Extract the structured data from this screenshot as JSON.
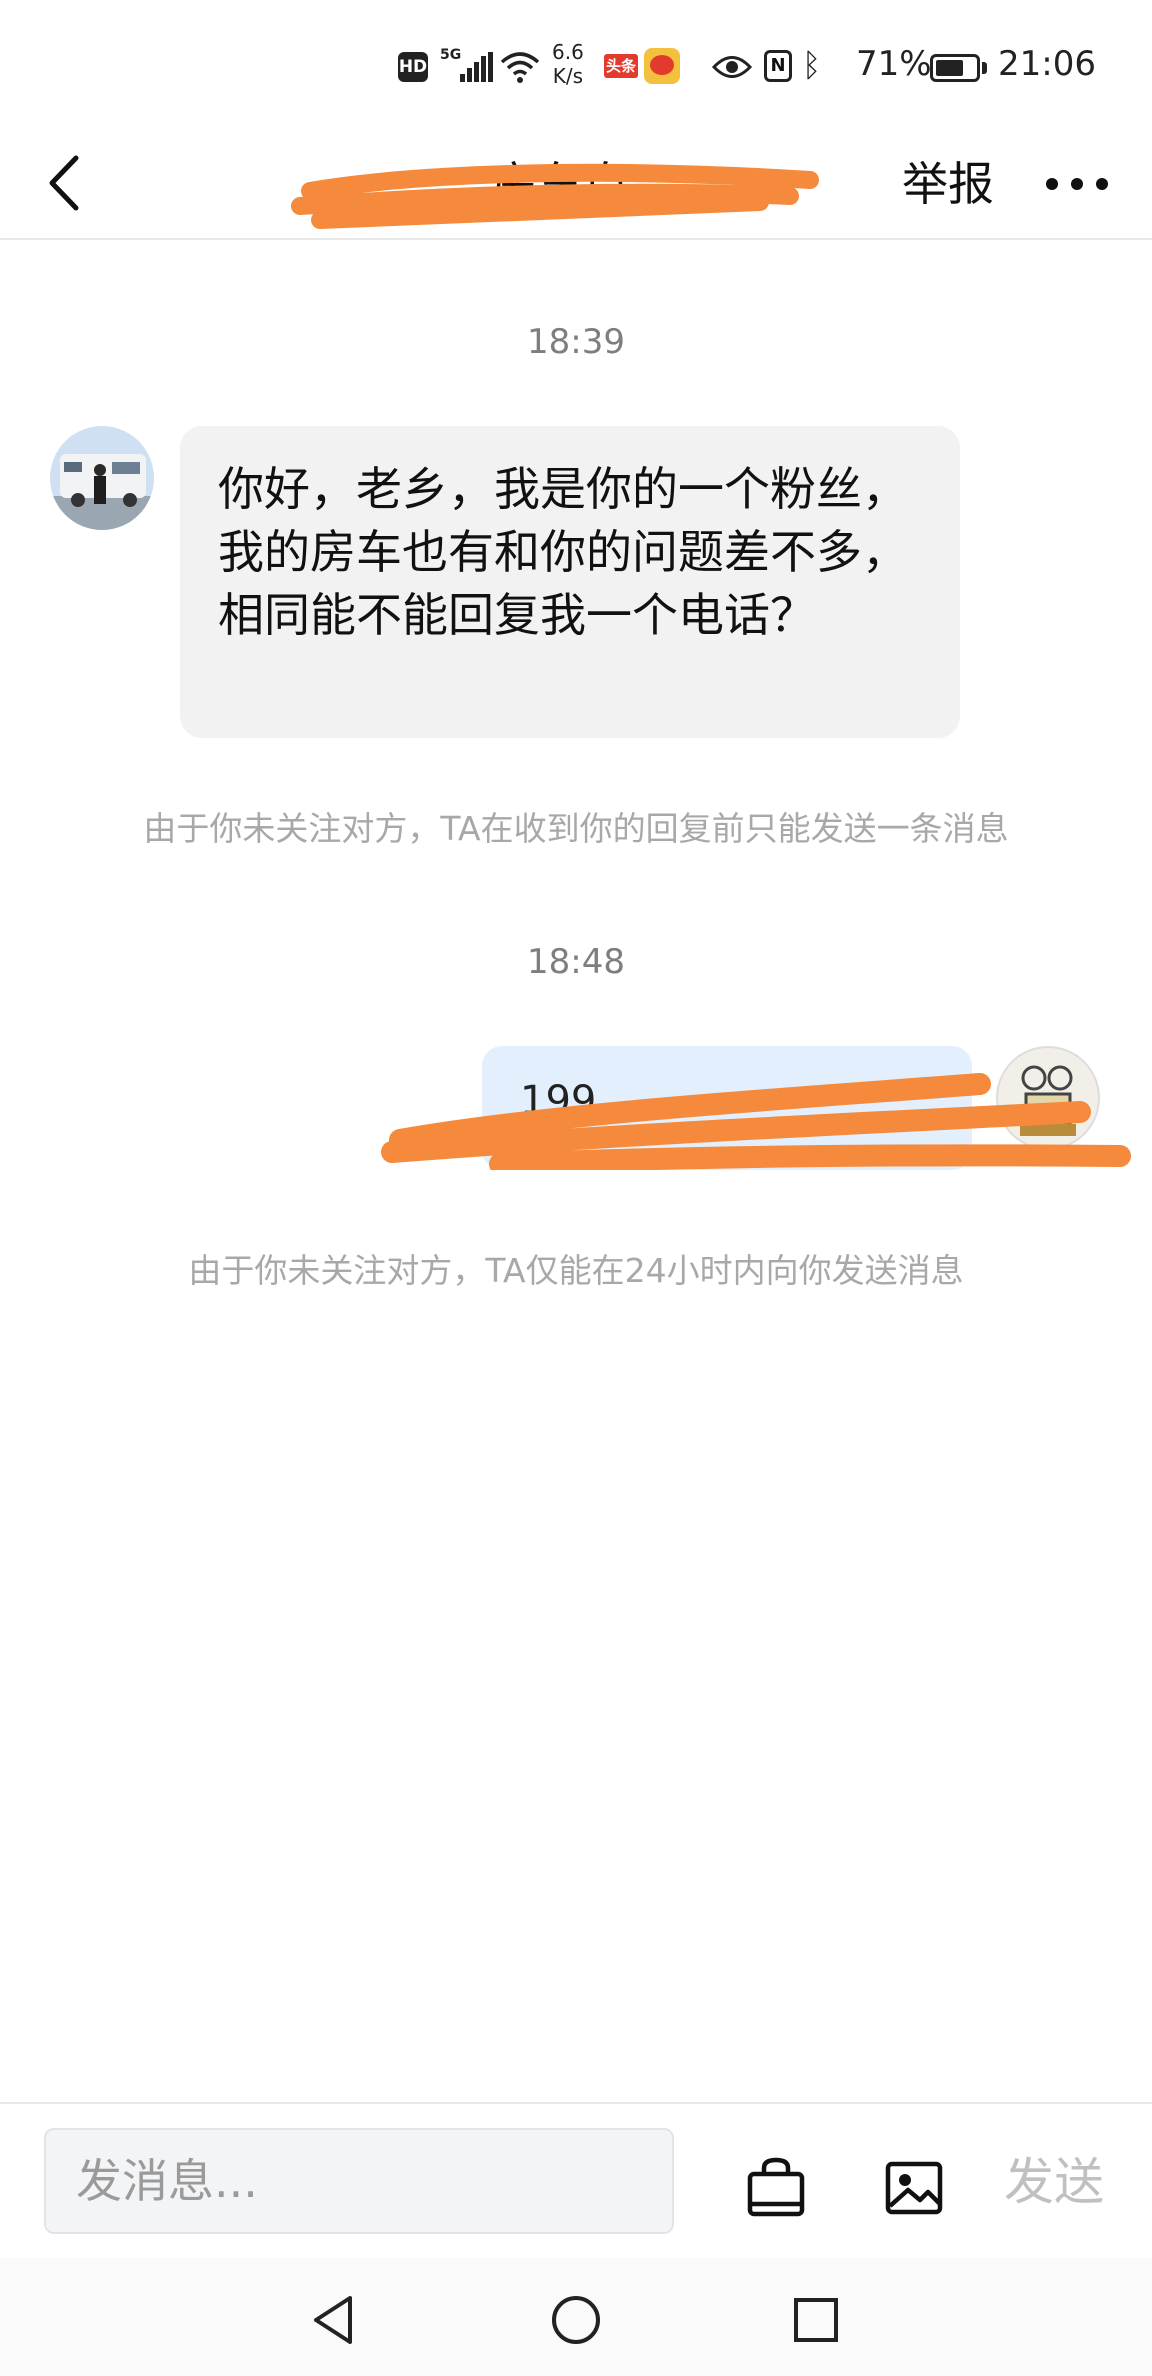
{
  "status_bar": {
    "hd_label": "HD",
    "network_label": "5G",
    "speed_value": "6.6",
    "speed_unit": "K/s",
    "toutiao_label": "头条",
    "nfc_label": "N",
    "battery_percent": "71%",
    "battery_level": 0.71,
    "time": "21:06",
    "icons": [
      "hd-icon",
      "signal-icon",
      "wifi-icon",
      "toutiao-app-icon",
      "weibo-app-icon",
      "eye-comfort-icon",
      "nfc-icon",
      "bluetooth-icon",
      "battery-icon"
    ]
  },
  "header": {
    "title": "…房车自…",
    "report_label": "举报",
    "icons": [
      "back-icon",
      "more-icon"
    ]
  },
  "messages": {
    "time1": "18:39",
    "incoming_text": "你好，老乡，我是你的一个粉丝，我的房车也有和你的问题差不多，相同能不能回复我一个电话？",
    "notice1": "由于你未关注对方，TA在收到你的回复前只能发送一条消息",
    "time2": "18:48",
    "outgoing_text": "199",
    "notice2": "由于你未关注对方，TA仅能在24小时内向你发送消息"
  },
  "composer": {
    "placeholder": "发消息...",
    "send_label": "发送",
    "icons": [
      "shopping-bag-icon",
      "image-icon"
    ]
  },
  "system_nav": {
    "icons": [
      "nav-back-icon",
      "nav-home-icon",
      "nav-recents-icon"
    ]
  },
  "colors": {
    "incoming_bubble": "#f2f2f2",
    "outgoing_bubble": "#e3effc",
    "redaction": "#f58a3c",
    "notice_text": "#a8a8a8",
    "send_disabled": "#c0c0c0"
  }
}
